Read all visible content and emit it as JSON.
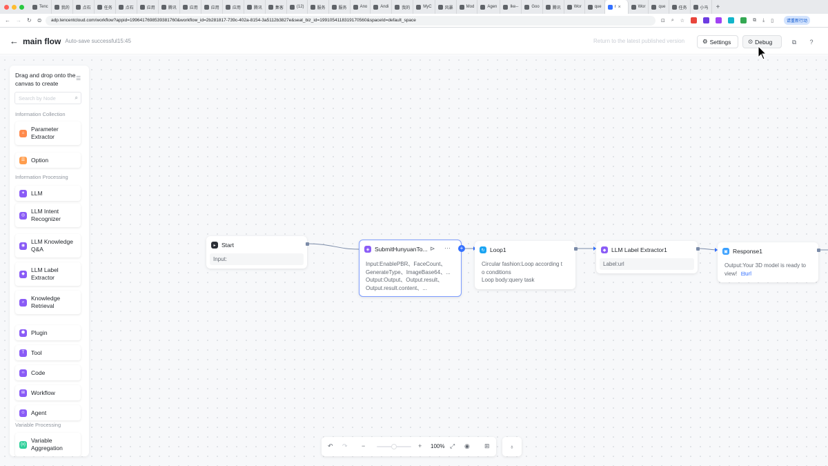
{
  "browser": {
    "tabs": [
      "Tenc",
      "我的",
      "点石",
      "任务",
      "点石",
      "应用",
      "腾讯",
      "应用",
      "应用",
      "应用",
      "腾讯",
      "集客",
      "(12)",
      "服务",
      "服务",
      "Ano",
      "Andi",
      "我的",
      "MyC",
      "风暴",
      "Mod",
      "Agen",
      "Ike--",
      "Goo",
      "腾讯",
      "Wor",
      "que"
    ],
    "active_tab": "r",
    "after_tabs": [
      "Wor",
      "que",
      "任务",
      "小马"
    ],
    "new_tab": "+",
    "url": "adp.tencentcloud.com/workflow?appid=1996417698539381760&workflow_id=2b281817-739c-402a-8154-3a5112b3827e&seat_biz_id=1991054118319170560&spaceId=default_space",
    "profile": "请重新行动"
  },
  "header": {
    "title": "main flow",
    "autosave": "Auto-save successful15:45",
    "return_link": "Return to the latest published version",
    "settings_label": "Settings",
    "debug_label": "Debug"
  },
  "sidebar": {
    "heading": "Drag and drop onto the canvas to create",
    "search_placeholder": "Search by Node",
    "categories": {
      "collection": "Information Collection",
      "processing": "Information Processing",
      "variable": "Variable Processing"
    },
    "items": [
      {
        "label": "Parameter Extractor",
        "color": "#ff8a4c",
        "icon": "parameter-extractor-icon"
      },
      {
        "label": "Option",
        "color": "#ff9d4d",
        "icon": "option-icon"
      },
      {
        "label": "LLM",
        "color": "#8a5cf6",
        "icon": "llm-icon"
      },
      {
        "label": "LLM Intent Recognizer",
        "color": "#8a5cf6",
        "icon": "intent-icon"
      },
      {
        "label": "LLM Knowledge Q&A",
        "color": "#8a5cf6",
        "icon": "knowledge-qa-icon"
      },
      {
        "label": "LLM Label Extractor",
        "color": "#8a5cf6",
        "icon": "label-extractor-icon"
      },
      {
        "label": "Knowledge Retrieval",
        "color": "#8a5cf6",
        "icon": "retrieval-icon"
      },
      {
        "label": "Plugin",
        "color": "#8a5cf6",
        "icon": "plugin-icon"
      },
      {
        "label": "Tool",
        "color": "#8a5cf6",
        "icon": "tool-icon"
      },
      {
        "label": "Code",
        "color": "#8a5cf6",
        "icon": "code-icon"
      },
      {
        "label": "Workflow",
        "color": "#8a5cf6",
        "icon": "workflow-icon"
      },
      {
        "label": "Agent",
        "color": "#8a5cf6",
        "icon": "agent-icon"
      },
      {
        "label": "Variable Aggregation",
        "color": "#2fcf9a",
        "icon": "variable-aggregation-icon"
      }
    ]
  },
  "nodes": {
    "start": {
      "title": "Start",
      "body": "Input:"
    },
    "submit": {
      "title": "SubmitHunyuanTo...",
      "body": [
        "Input:EnablePBR、FaceCount、",
        "GenerateType、ImageBase64、...",
        "Output:Output、Output.result、",
        "Output.result.content、..."
      ]
    },
    "loop": {
      "title": "Loop1",
      "body": [
        "Circular fashion:Loop according t",
        "o conditions",
        "Loop body:query task"
      ]
    },
    "label": {
      "title": "LLM Label Extractor1",
      "body": "Label:url"
    },
    "response": {
      "title": "Response1",
      "body_text": "Output:Your 3D model is ready to",
      "body_text2": "view!",
      "var_tag": "url"
    }
  },
  "toolbar": {
    "zoom": "100%",
    "zoom_level": 0.5
  },
  "colors": {
    "accent": "#3370ff",
    "start_icon": "#2b2f36",
    "purple": "#8a5cf6",
    "blue_loop": "#1aa4f2",
    "response": "#3aa0ff"
  }
}
